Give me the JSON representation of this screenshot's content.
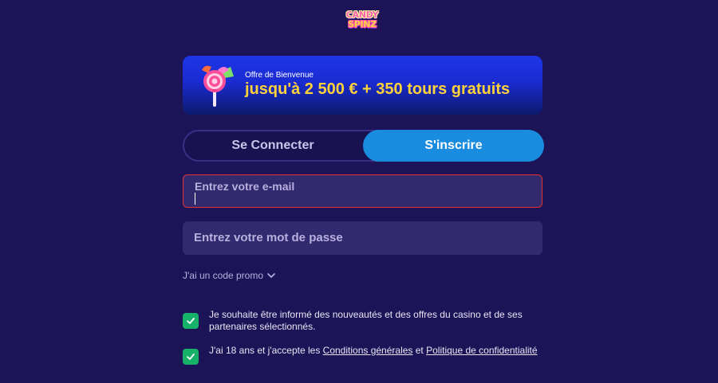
{
  "logo": {
    "line1": "CANDY",
    "line2": "SPINZ"
  },
  "banner": {
    "subtitle": "Offre de Bienvenue",
    "headline": "jusqu'à 2 500 € + 350 tours gratuits",
    "icon": "lollipop-candy-icon"
  },
  "tabs": {
    "login": "Se Connecter",
    "signup": "S'inscrire",
    "active": "signup"
  },
  "form": {
    "email_placeholder": "Entrez votre e-mail",
    "password_placeholder": "Entrez votre mot de passe",
    "promo_label": "J'ai un code promo"
  },
  "consents": [
    {
      "checked": true,
      "text": "Je souhaite être informé des nouveautés et des offres du casino et de ses partenaires sélectionnés."
    },
    {
      "checked": true,
      "text_prefix": "J'ai 18 ans et j'accepte les ",
      "link1": "Conditions générales",
      "text_mid": " et ",
      "link2": "Politique de confidentialité"
    }
  ],
  "colors": {
    "background": "#1c1457",
    "accent_blue": "#1a8ce0",
    "headline_yellow": "#ffd23a",
    "error_border": "#e0312f",
    "check_green": "#17b169"
  }
}
